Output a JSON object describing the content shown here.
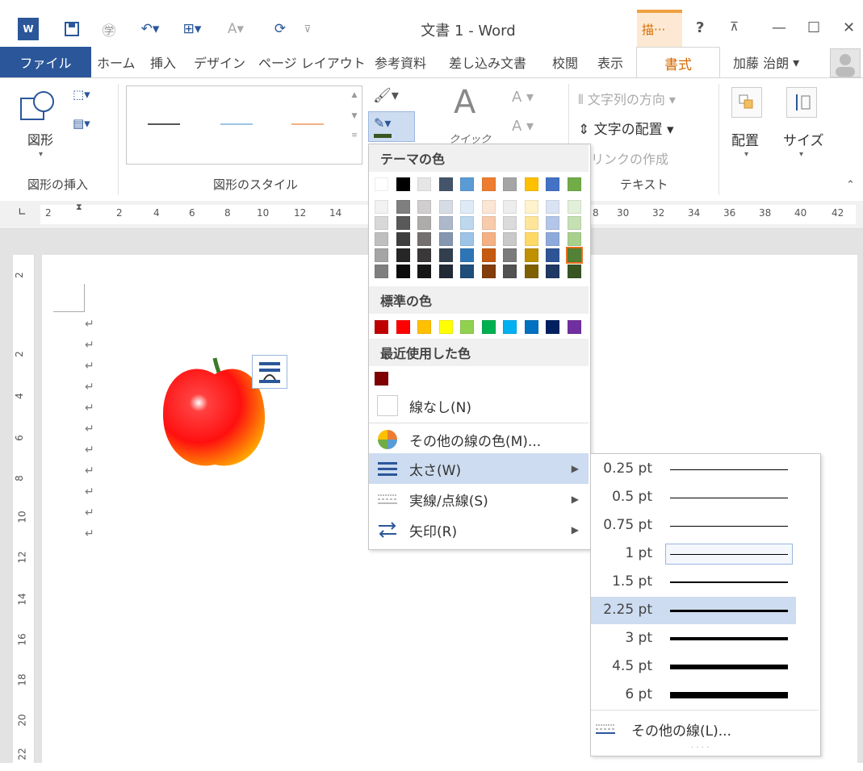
{
  "window": {
    "title": "文書 1 - Word",
    "context_tab": "描···"
  },
  "quick_access": {
    "redo_label": "⟳"
  },
  "tabs": [
    "ファイル",
    "ホーム",
    "挿入",
    "デザイン",
    "ページ レイアウト",
    "参考資料",
    "差し込み文書",
    "校閲",
    "表示",
    "書式"
  ],
  "user": {
    "name": "加藤 治朗"
  },
  "ribbon": {
    "shape_label": "図形",
    "quick_label": "クイック",
    "text_direction": "文字列の方向",
    "text_align": "文字の配置",
    "link": "リンクの作成",
    "arrange": "配置",
    "size": "サイズ",
    "groups": {
      "insert_shapes": "図形の挿入",
      "shape_styles": "図形のスタイル",
      "text": "テキスト"
    }
  },
  "ruler": {
    "ticks": [
      "2",
      "2",
      "4",
      "6",
      "8",
      "10",
      "12",
      "14",
      "8",
      "30",
      "32",
      "34",
      "36",
      "38",
      "40",
      "42"
    ]
  },
  "vruler": {
    "ticks": [
      "2",
      "2",
      "4",
      "6",
      "8",
      "10",
      "12",
      "14",
      "16",
      "18",
      "20",
      "22"
    ]
  },
  "menu": {
    "theme_colors_title": "テーマの色",
    "standard_colors_title": "標準の色",
    "recent_colors_title": "最近使用した色",
    "theme_top": [
      "#ffffff",
      "#000000",
      "#e7e6e6",
      "#44546a",
      "#5b9bd5",
      "#ed7d31",
      "#a5a5a5",
      "#ffc000",
      "#4472c4",
      "#70ad47"
    ],
    "theme_shades": [
      [
        "#f2f2f2",
        "#7f7f7f",
        "#d0cece",
        "#d6dce4",
        "#deebf6",
        "#fbe5d5",
        "#ededed",
        "#fff2cc",
        "#dae3f3",
        "#e2efd9"
      ],
      [
        "#d8d8d8",
        "#595959",
        "#aeabab",
        "#adb9ca",
        "#bdd7ee",
        "#f7cbac",
        "#dbdbdb",
        "#fee599",
        "#b4c6e7",
        "#c5e0b3"
      ],
      [
        "#bfbfbf",
        "#3f3f3f",
        "#757070",
        "#8496b0",
        "#9dc3e6",
        "#f4b183",
        "#c9c9c9",
        "#ffd965",
        "#8eaadb",
        "#a8d08d"
      ],
      [
        "#a5a5a5",
        "#262626",
        "#3a3838",
        "#323f4f",
        "#2e75b5",
        "#c55a11",
        "#7b7b7b",
        "#bf9000",
        "#2f5496",
        "#538135"
      ],
      [
        "#7f7f7f",
        "#0c0c0c",
        "#171616",
        "#222a35",
        "#1e4e79",
        "#833c0b",
        "#525252",
        "#7f6000",
        "#1f3864",
        "#375623"
      ]
    ],
    "standard": [
      "#c00000",
      "#ff0000",
      "#ffc000",
      "#ffff00",
      "#92d050",
      "#00b050",
      "#00b0f0",
      "#0070c0",
      "#002060",
      "#7030a0"
    ],
    "recent": [
      "#7f0000"
    ],
    "no_line": "線なし(N)",
    "more_colors": "その他の線の色(M)...",
    "weight": "太さ(W)",
    "dash": "実線/点線(S)",
    "arrows": "矢印(R)"
  },
  "weights": {
    "items": [
      {
        "label": "0.25 pt",
        "pt": 0.25
      },
      {
        "label": "0.5 pt",
        "pt": 0.5
      },
      {
        "label": "0.75 pt",
        "pt": 0.75
      },
      {
        "label": "1 pt",
        "pt": 1
      },
      {
        "label": "1.5 pt",
        "pt": 1.5
      },
      {
        "label": "2.25 pt",
        "pt": 2.25
      },
      {
        "label": "3 pt",
        "pt": 3
      },
      {
        "label": "4.5 pt",
        "pt": 4.5
      },
      {
        "label": "6 pt",
        "pt": 6
      }
    ],
    "more": "その他の線(L)..."
  }
}
